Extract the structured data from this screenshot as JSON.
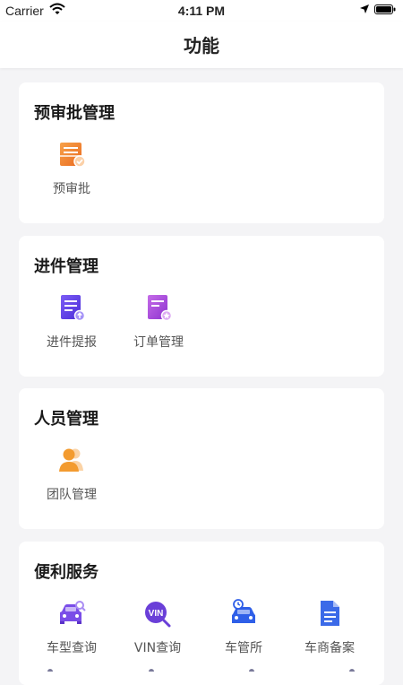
{
  "status_bar": {
    "carrier": "Carrier",
    "time": "4:11 PM"
  },
  "header": {
    "title": "功能"
  },
  "sections": [
    {
      "title": "预审批管理",
      "items": [
        {
          "label": "预审批",
          "icon": "pre-approval-icon"
        }
      ]
    },
    {
      "title": "进件管理",
      "items": [
        {
          "label": "进件提报",
          "icon": "application-submit-icon"
        },
        {
          "label": "订单管理",
          "icon": "order-management-icon"
        }
      ]
    },
    {
      "title": "人员管理",
      "items": [
        {
          "label": "团队管理",
          "icon": "team-icon"
        }
      ]
    },
    {
      "title": "便利服务",
      "items": [
        {
          "label": "车型查询",
          "icon": "car-model-search-icon"
        },
        {
          "label": "VIN查询",
          "icon": "vin-search-icon"
        },
        {
          "label": "车管所",
          "icon": "vehicle-office-icon"
        },
        {
          "label": "车商备案",
          "icon": "dealer-filing-icon"
        }
      ]
    }
  ],
  "colors": {
    "orange": "#f28a2e",
    "purple": "#6c4cf0",
    "violet": "#b44fe0",
    "blue": "#2f5fe8"
  }
}
